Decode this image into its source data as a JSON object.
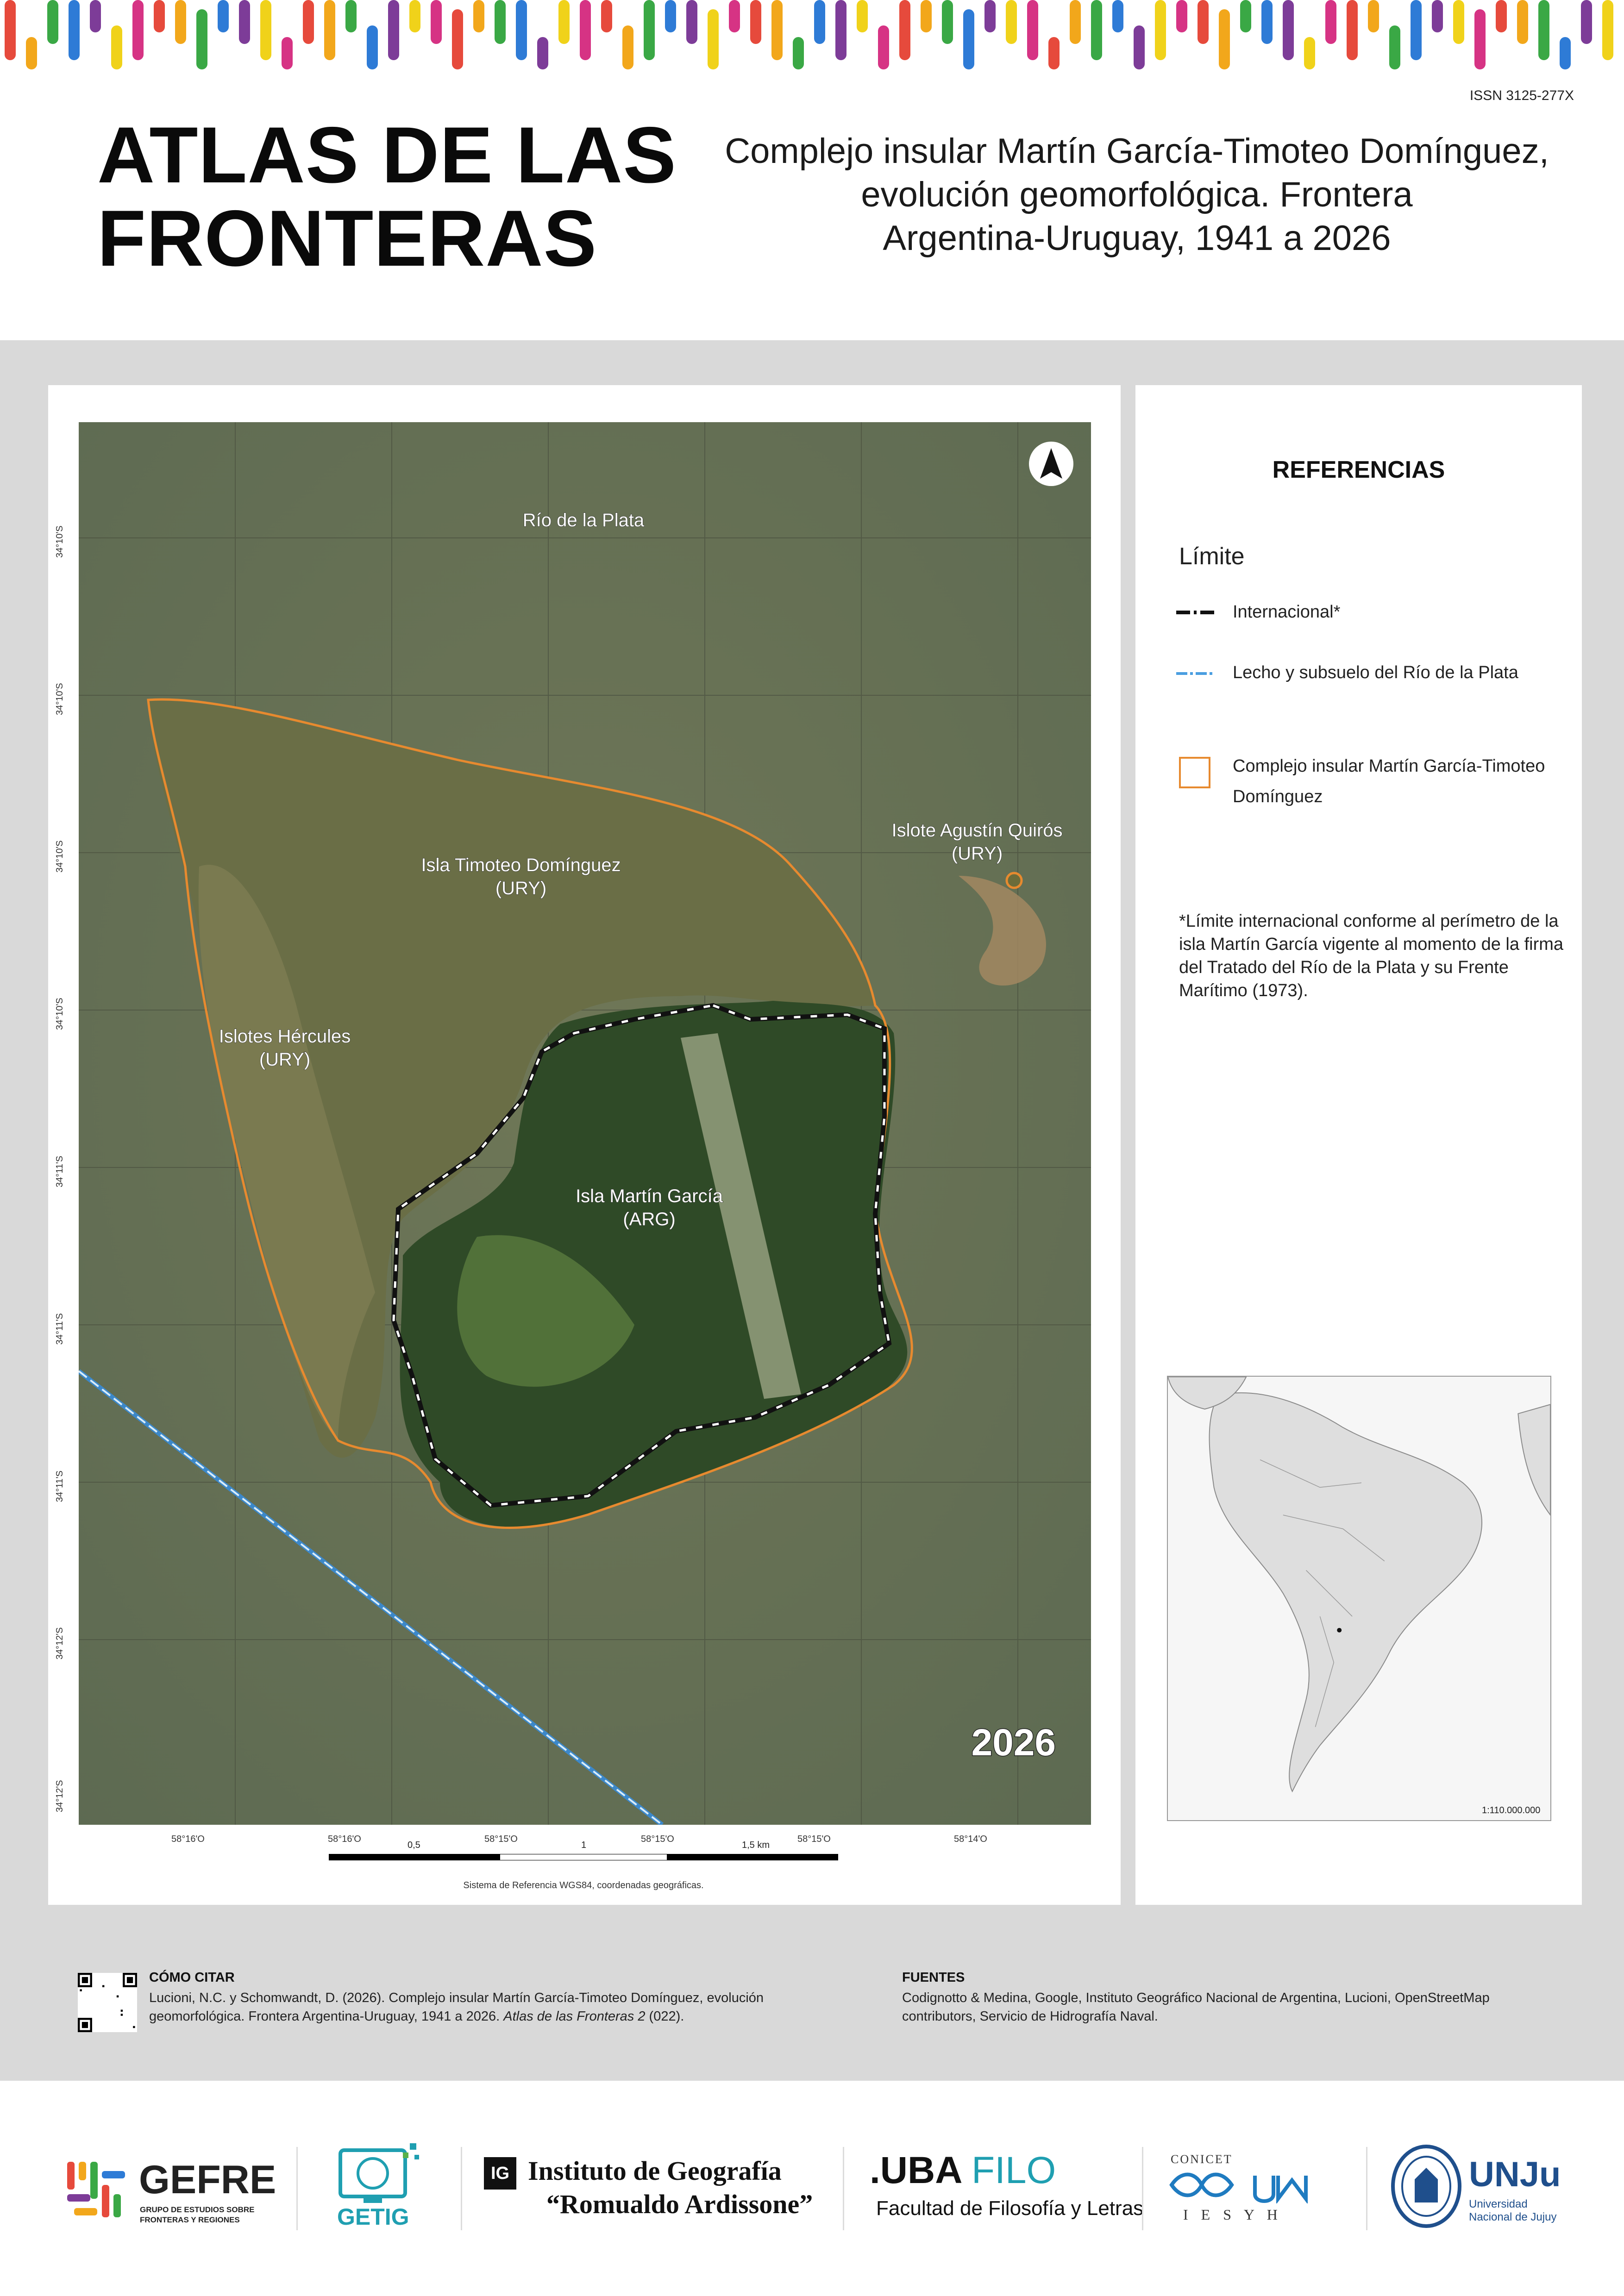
{
  "issn": "ISSN 3125-277X",
  "atlas_title": [
    "ATLAS DE LAS",
    "FRONTERAS"
  ],
  "map_title": [
    "Complejo insular Martín García-Timoteo Domínguez,",
    "evolución geomorfológica. Frontera",
    "Argentina-Uruguay, 1941 a 2026"
  ],
  "map": {
    "year_stamp": "2026",
    "place_labels": {
      "rio": "Río de la Plata",
      "timoteo_name": "Isla Timoteo Domínguez",
      "timoteo_country": "(URY)",
      "quiros_name": "Islote Agustín Quirós",
      "quiros_country": "(URY)",
      "hercules_name": "Islotes Hércules",
      "hercules_country": "(URY)",
      "martin_name": "Isla Martín García",
      "martin_country": "(ARG)"
    },
    "lat_labels": [
      "34°10'S",
      "34°10'S",
      "34°10'S",
      "34°10'S",
      "34°11'S",
      "34°11'S",
      "34°11'S",
      "34°12'S",
      "34°12'S"
    ],
    "lon_labels": [
      "58°16'O",
      "58°16'O",
      "58°15'O",
      "58°15'O",
      "58°15'O",
      "58°14'O"
    ],
    "scale": {
      "a": "0,5",
      "b": "1",
      "c": "1,5 km"
    },
    "reference_system": "Sistema de Referencia WGS84, coordenadas geográficas."
  },
  "legend": {
    "title": "REFERENCIAS",
    "section": "Límite",
    "items": [
      {
        "label": "Internacional*"
      },
      {
        "label": "Lecho y subsuelo del Río de la Plata"
      },
      {
        "label": "Complejo insular Martín García-Timoteo Domínguez"
      }
    ],
    "footnote": "*Límite internacional conforme al perímetro de la isla Martín García vigente al momento de la firma del Tratado del Río de la Plata y su Frente Marítimo (1973).",
    "locator_scale": "1:110.000.000"
  },
  "colors": {
    "complex_outline": "#e78a2f",
    "international": "#111111",
    "riverbed": "#5aa9e6",
    "water": "#6d7558"
  },
  "citation": {
    "heading": "CÓMO CITAR",
    "text": "Lucioni, N.C. y Schomwandt, D. (2026). Complejo insular Martín García-Timoteo Domínguez, evolución geomorfológica. Frontera Argentina-Uruguay, 1941 a 2026.",
    "journal": "Atlas de las Fronteras 2",
    "issue": " (022)."
  },
  "sources": {
    "heading": "FUENTES",
    "text": "Codignotto & Medina, Google, Instituto Geográfico Nacional de Argentina, Lucioni, OpenStreetMap contributors, Servicio de Hidrografía Naval."
  },
  "logos": {
    "gefre": "GEFRE",
    "gefre_sub1": "GRUPO DE ESTUDIOS SOBRE",
    "gefre_sub2": "FRONTERAS Y REGIONES",
    "getig": "GETIG",
    "ig_mark": "IG",
    "ig_line1": "Instituto de Geografía",
    "ig_line2": "“Romualdo Ardissone”",
    "uba": ".UBA",
    "filo": "FILO",
    "uba_sub": "Facultad de Filosofía y Letras",
    "conicet": "CONICET",
    "iesyh": "I E S Y H",
    "unju": "UNJu",
    "unju_sub1": "Universidad",
    "unju_sub2": "Nacional de Jujuy"
  }
}
